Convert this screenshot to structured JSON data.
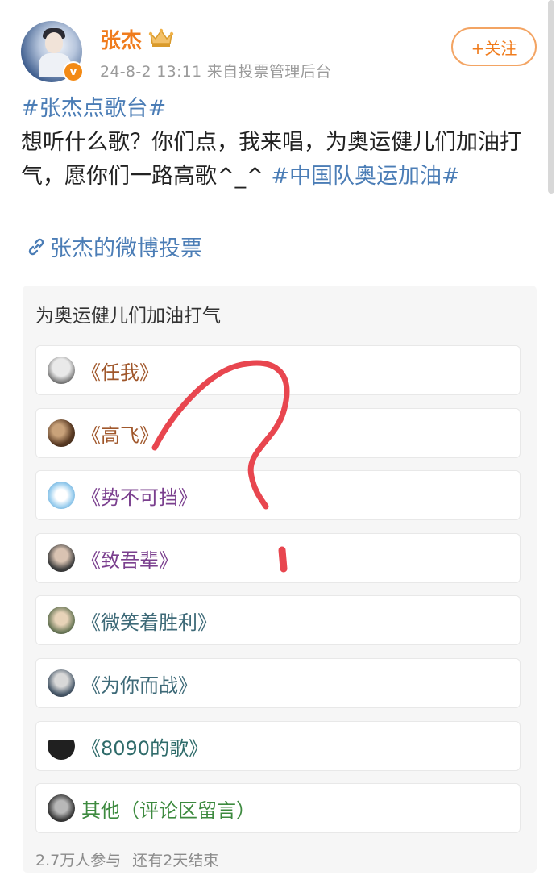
{
  "author": {
    "name": "张杰",
    "meta": "24-8-2 13:11  来自投票管理后台",
    "verified_mark": "v",
    "follow_label": "+关注"
  },
  "post": {
    "hashtag1": "#张杰点歌台#",
    "text": "想听什么歌？你们点，我来唱，为奥运健儿们加油打气，愿你们一路高歌^_^ ",
    "hashtag2": "#中国队奥运加油#",
    "vote_link": "张杰的微博投票"
  },
  "poll": {
    "title": "为奥运健儿们加油打气",
    "options": [
      {
        "label": "《任我》",
        "color": "#a0572b"
      },
      {
        "label": "《高飞》",
        "color": "#a0572b"
      },
      {
        "label": "《势不可挡》",
        "color": "#7a3f8e"
      },
      {
        "label": "《致吾辈》",
        "color": "#7a3f8e"
      },
      {
        "label": "《微笑着胜利》",
        "color": "#3e6a78"
      },
      {
        "label": "《为你而战》",
        "color": "#3e6a78"
      },
      {
        "label": "《8090的歌》",
        "color": "#2f6b6a"
      },
      {
        "label": "其他（评论区留言）",
        "color": "#3d8a3f"
      }
    ],
    "participants": "2.7万人参与",
    "remaining": "还有2天结束"
  },
  "colors": {
    "brand_orange": "#f07c1d",
    "hashtag_blue": "#4b7db6",
    "scribble_red": "#e8464f"
  },
  "icons": [
    "crown-icon",
    "link-icon",
    "verified-icon"
  ]
}
